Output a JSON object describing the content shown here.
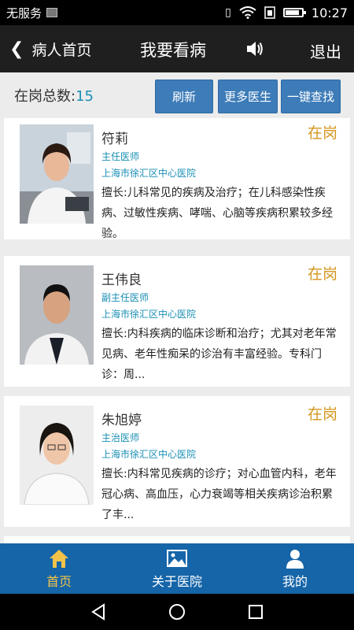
{
  "status_bar": {
    "carrier": "无服务",
    "time": "10:27",
    "battery_level": 0.85
  },
  "header": {
    "back_label": "病人首页",
    "title": "我要看病",
    "logout_label": "退出"
  },
  "count_bar": {
    "label": "在岗总数:",
    "value": "15",
    "buttons": {
      "refresh": "刷新",
      "more_doctors": "更多医生",
      "one_click_search": "一键查找"
    }
  },
  "doctors": [
    {
      "name": "符莉",
      "title": "主任医师",
      "hospital": "上海市徐汇区中心医院",
      "specialty": "擅长:儿科常见的疾病及治疗；在儿科感染性疾病、过敏性疾病、哮喘、心脑等疾病积累较多经验。",
      "status": "在岗"
    },
    {
      "name": "王伟良",
      "title": "副主任医师",
      "hospital": "上海市徐汇区中心医院",
      "specialty": "擅长:内科疾病的临床诊断和治疗；尤其对老年常见病、老年性痴呆的诊治有丰富经验。专科门诊：周...",
      "status": "在岗"
    },
    {
      "name": "朱旭婷",
      "title": "主治医师",
      "hospital": "上海市徐汇区中心医院",
      "specialty": "擅长:内科常见疾病的诊疗；对心血管内科，老年冠心病、高血压，心力衰竭等相关疾病诊治积累了丰...",
      "status": "在岗"
    }
  ],
  "tab_bar": {
    "home": "首页",
    "about_hospital": "关于医院",
    "mine": "我的"
  },
  "colors": {
    "accent_blue": "#1565a8",
    "link_blue": "#1a8fb5",
    "status_gold": "#d4961e",
    "active_tab": "#f3c24a"
  }
}
